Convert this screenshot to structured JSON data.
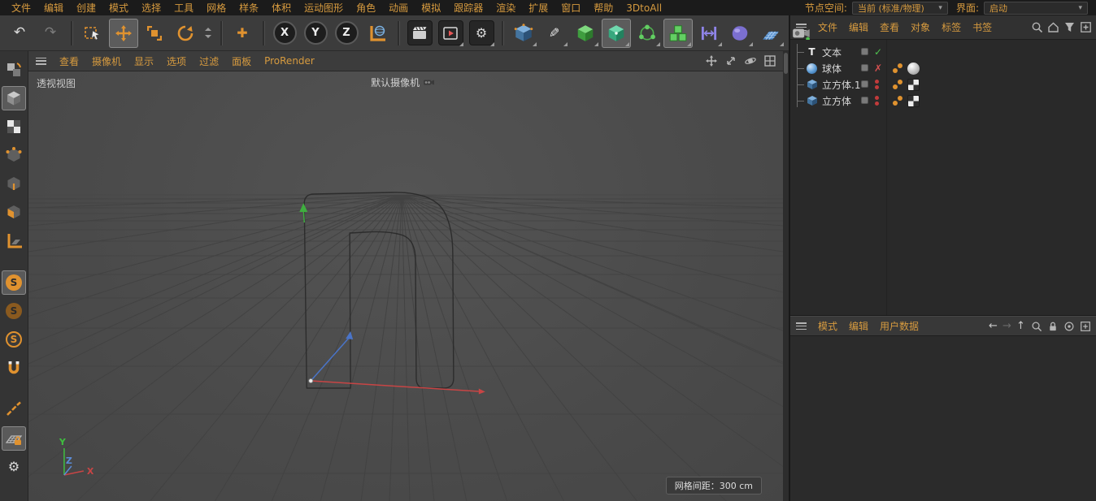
{
  "menubar": {
    "items": [
      "文件",
      "编辑",
      "创建",
      "模式",
      "选择",
      "工具",
      "网格",
      "样条",
      "体积",
      "运动图形",
      "角色",
      "动画",
      "模拟",
      "跟踪器",
      "渲染",
      "扩展",
      "窗口",
      "帮助",
      "3DtoAll"
    ],
    "node_space_label": "节点空间:",
    "node_space_value": "当前 (标准/物理)",
    "interface_label": "界面:",
    "interface_value": "启动",
    "caret": "▾"
  },
  "toolbar": {
    "icons": [
      "undo",
      "redo",
      "live-selection",
      "move",
      "scale",
      "rotate",
      "recent-tools",
      "enable-axis",
      "lock-x",
      "lock-y",
      "lock-z",
      "coordinate-system",
      "render-view",
      "render-to-picture-viewer",
      "edit-render-settings",
      "add-cube",
      "pen-spline",
      "subdivision-surface",
      "volume-builder",
      "cloner",
      "array",
      "deformer",
      "field",
      "floor",
      "camera"
    ],
    "undo_glyph": "↶",
    "redo_glyph": "↷",
    "plus_glyph": "✚",
    "pen_glyph": "✎",
    "gear_glyph": "⚙",
    "lock_x": "X",
    "lock_y": "Y",
    "lock_z": "Z"
  },
  "palette": {
    "icons": [
      "make-editable",
      "model-mode",
      "texture-mode",
      "points-mode",
      "edges-mode",
      "polygons-mode",
      "workplane-mode",
      "solo-off",
      "solo-single",
      "solo-hierarchy",
      "snap",
      "quantize",
      "lock-workplane",
      "modeling-settings"
    ],
    "solo_glyph": "S",
    "gear_glyph": "⚙"
  },
  "viewport": {
    "menu": [
      "查看",
      "摄像机",
      "显示",
      "选项",
      "过滤",
      "面板",
      "ProRender"
    ],
    "view_label": "透视视图",
    "camera_label": "默认摄像机",
    "grid_info": "网格间距：300 cm",
    "axis_x": "X",
    "axis_y": "Y",
    "axis_z": "Z"
  },
  "object_manager": {
    "menu": [
      "文件",
      "编辑",
      "查看",
      "对象",
      "标签",
      "书签"
    ],
    "objects": [
      {
        "name": "文本",
        "icon": "text-spline",
        "icon_glyph": "T",
        "state": "✓"
      },
      {
        "name": "球体",
        "icon": "sphere",
        "state": "✗"
      },
      {
        "name": "立方体.1",
        "icon": "cube",
        "state": ""
      },
      {
        "name": "立方体",
        "icon": "cube",
        "state": ""
      }
    ],
    "tags": {
      "sphere_row": [
        "phong-tag",
        "material-tag"
      ],
      "cube1_row": [
        "phong-tag",
        "texture-tag"
      ],
      "cube_row": [
        "phong-tag",
        "texture-tag"
      ]
    }
  },
  "attribute_manager": {
    "menu": [
      "模式",
      "编辑",
      "用户数据"
    ],
    "back_glyph": "←",
    "forward_glyph": "→",
    "up_glyph": "↑"
  }
}
